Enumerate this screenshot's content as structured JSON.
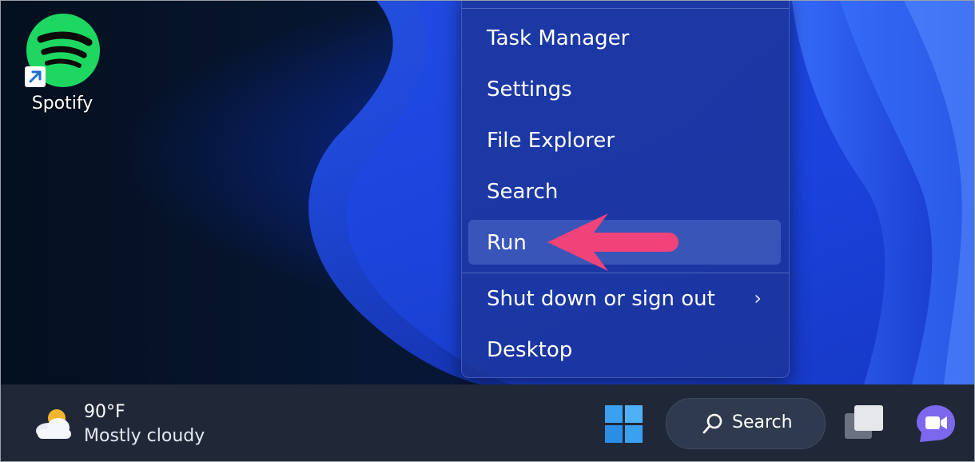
{
  "desktop": {
    "icons": [
      {
        "label": "Spotify",
        "icon": "spotify-logo-icon",
        "shortcut": true
      }
    ]
  },
  "context_menu": {
    "items": [
      {
        "label": "Task Manager"
      },
      {
        "label": "Settings"
      },
      {
        "label": "File Explorer"
      },
      {
        "label": "Search"
      },
      {
        "label": "Run",
        "highlighted": true
      },
      {
        "label": "Shut down or sign out",
        "submenu": true
      },
      {
        "label": "Desktop"
      }
    ],
    "submenu_icon": "chevron-right-icon",
    "chevron_glyph": "›"
  },
  "annotation": {
    "arrow_color": "#f0437a",
    "points_to": "Run"
  },
  "taskbar": {
    "weather": {
      "temperature": "90°F",
      "description": "Mostly cloudy",
      "icon": "partly-cloudy-icon"
    },
    "search": {
      "label": "Search",
      "icon": "search-icon"
    },
    "start_icon": "windows-start-icon",
    "task_view_icon": "task-view-icon",
    "chat_icon": "teams-chat-icon"
  },
  "colors": {
    "spotify_green": "#1ed760",
    "start_blue": "#3aa0f0",
    "taskbar_bg": "#202838",
    "menu_bg": "#1c3496"
  }
}
